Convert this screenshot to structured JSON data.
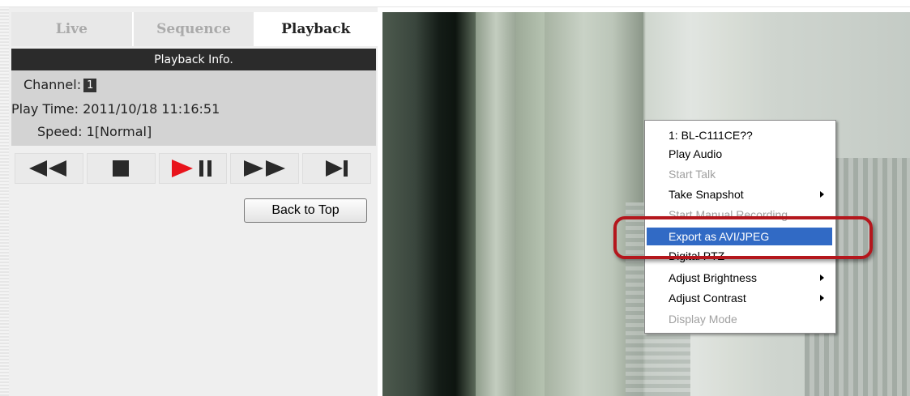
{
  "tabs": [
    {
      "label": "Live",
      "active": false
    },
    {
      "label": "Sequence",
      "active": false
    },
    {
      "label": "Playback",
      "active": true
    }
  ],
  "playback_info": {
    "header": "Playback Info.",
    "channel_label": "Channel:",
    "channel_value": "1",
    "play_time_label": "Play Time:",
    "play_time_value": "2011/10/18 11:16:51",
    "speed_label": "Speed:",
    "speed_value": "1[Normal]"
  },
  "controls": [
    {
      "icon": "rewind-icon"
    },
    {
      "icon": "stop-icon"
    },
    {
      "icon": "play-pause-icon"
    },
    {
      "icon": "fast-forward-icon"
    },
    {
      "icon": "skip-to-end-icon"
    }
  ],
  "back_to_top_label": "Back to Top",
  "context_menu": {
    "items": [
      {
        "label": "1: BL-C111CE??",
        "disabled": false,
        "submenu": false,
        "selected": false
      },
      {
        "label": "Play Audio",
        "disabled": false,
        "submenu": false,
        "selected": false
      },
      {
        "label": "Start Talk",
        "disabled": true,
        "submenu": false,
        "selected": false
      },
      {
        "label": "Take Snapshot",
        "disabled": false,
        "submenu": true,
        "selected": false
      },
      {
        "label": "Start Manual Recording",
        "disabled": true,
        "submenu": false,
        "selected": false
      },
      {
        "label": "Export as AVI/JPEG",
        "disabled": false,
        "submenu": false,
        "selected": true
      },
      {
        "label": "Digital PTZ",
        "disabled": false,
        "submenu": false,
        "selected": false
      },
      {
        "label": "Adjust Brightness",
        "disabled": false,
        "submenu": true,
        "selected": false
      },
      {
        "label": "Adjust Contrast",
        "disabled": false,
        "submenu": true,
        "selected": false
      },
      {
        "label": "Display Mode",
        "disabled": true,
        "submenu": false,
        "selected": false
      }
    ]
  },
  "colors": {
    "menu_selection": "#316ac5",
    "play_accent": "#e8141c",
    "highlight_ring": "#b4171d",
    "info_header_bg": "#2b2b2b"
  }
}
